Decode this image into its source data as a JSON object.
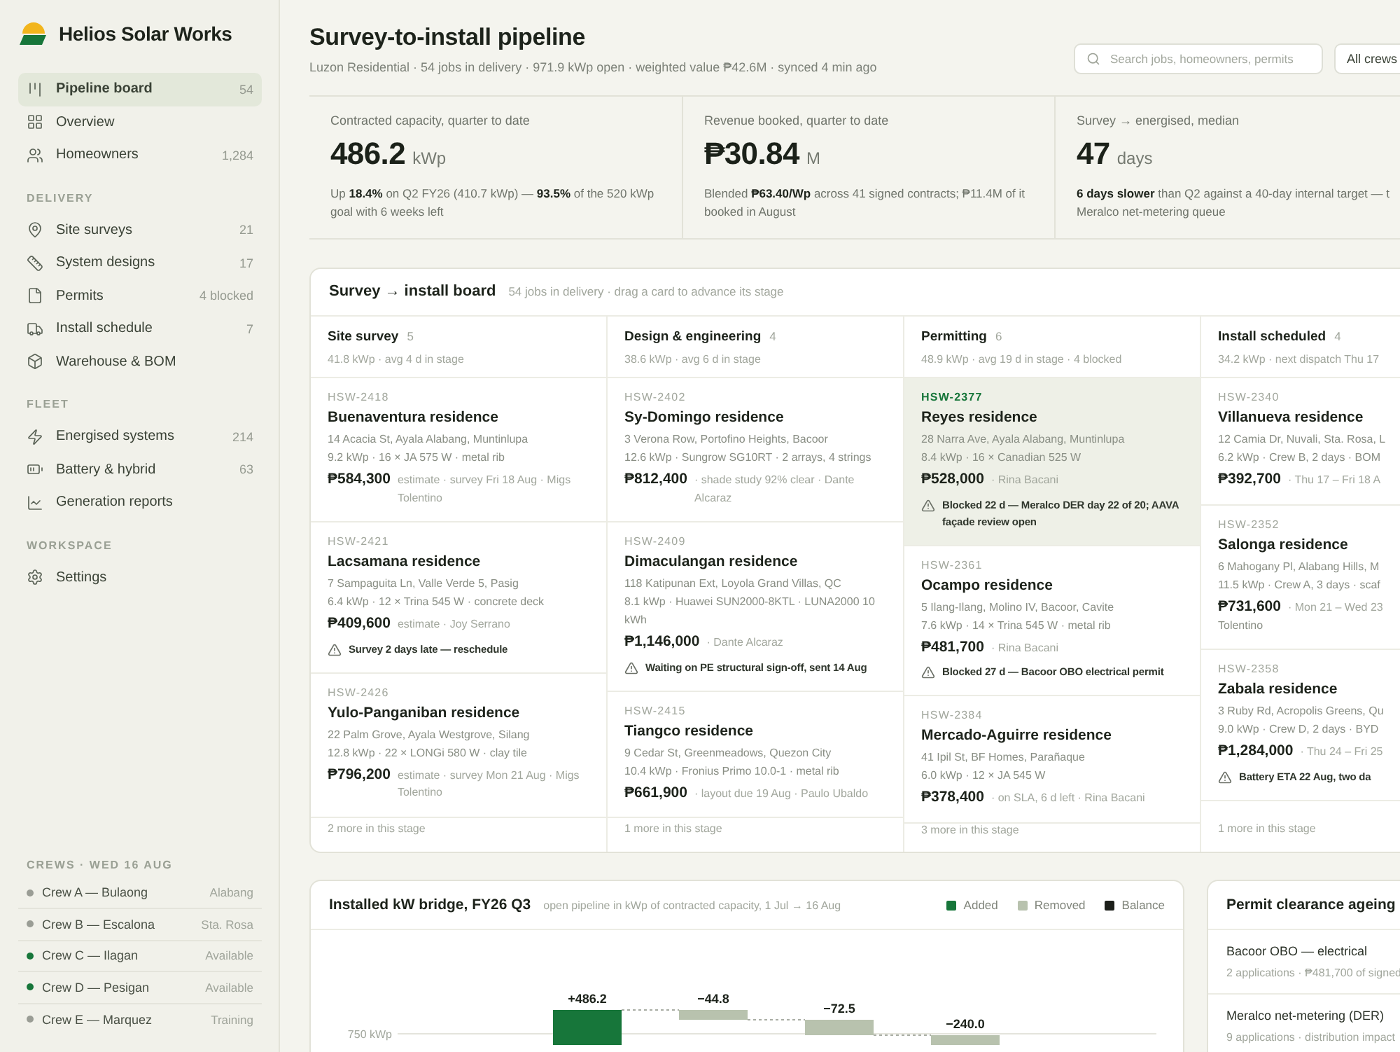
{
  "sidebar": {
    "brand": "Helios Solar Works",
    "nav": [
      {
        "label": "Pipeline board",
        "count": "54",
        "selected": true
      },
      {
        "label": "Overview",
        "selected": false
      },
      {
        "label": "Homeowners",
        "count": "1,284",
        "selected": false
      }
    ],
    "sections": [
      {
        "title": "DELIVERY",
        "items": [
          {
            "label": "Site surveys",
            "count": "21",
            "selected": false
          },
          {
            "label": "System designs",
            "count": "17",
            "selected": false
          },
          {
            "label": "Permits",
            "count": "4 blocked",
            "selected": false
          },
          {
            "label": "Install schedule",
            "count": "7",
            "selected": false
          },
          {
            "label": "Warehouse & BOM",
            "selected": false
          }
        ]
      },
      {
        "title": "FLEET",
        "items": [
          {
            "label": "Energised systems",
            "count": "214",
            "selected": false
          },
          {
            "label": "Battery & hybrid",
            "count": "63",
            "selected": false
          },
          {
            "label": "Generation reports",
            "selected": false
          }
        ]
      },
      {
        "title": "WORKSPACE",
        "items": [
          {
            "label": "Settings",
            "selected": false
          }
        ]
      }
    ],
    "crews": {
      "title": "CREWS · WED 16 AUG",
      "items": [
        {
          "name": "Crew A — Bulaong",
          "status": "Alabang",
          "color": "#9a9d95"
        },
        {
          "name": "Crew B — Escalona",
          "status": "Sta. Rosa",
          "color": "#9a9d95"
        },
        {
          "name": "Crew C — Ilagan",
          "status": "Available",
          "color": "#17763a"
        },
        {
          "name": "Crew D — Pesigan",
          "status": "Available",
          "color": "#17763a"
        },
        {
          "name": "Crew E — Marquez",
          "status": "Training",
          "color": "#9a9d95"
        }
      ]
    }
  },
  "header": {
    "title": "Survey-to-install pipeline",
    "subtitle": "Luzon Residential · 54 jobs in delivery · 971.9 kWp open · weighted value ₱42.6M · synced 4 min ago",
    "search": {
      "placeholder": "Search jobs, homeowners, permits"
    },
    "crew_filter": {
      "value": "All crews"
    }
  },
  "kpis": [
    {
      "label": "Contracted capacity, quarter to date",
      "value": "486.2",
      "unit": "kWp",
      "lines": [
        "Up **18.4%** on Q2 FY26 (410.7 kWp) — **93.5%** of the 520 kWp",
        "goal with 6 weeks left"
      ]
    },
    {
      "label": "Revenue booked, quarter to date",
      "value": "₱30.84",
      "unit": "M",
      "lines": [
        "Blended **₱63.40/Wp** across 41 signed contracts; ₱11.4M of it",
        "booked in August"
      ]
    },
    {
      "label": "Survey → energised, median",
      "value": "47",
      "unit": "days",
      "lines": [
        "**6 days slower** than Q2 against a 40-day internal target — t",
        "Meralco net-metering queue"
      ]
    }
  ],
  "board": {
    "title": "Survey → install board",
    "subtitle": "54 jobs in delivery · drag a card to advance its stage",
    "columns": [
      {
        "title": "Site survey",
        "count": "5",
        "summary": "41.8 kWp · avg 4 d in stage",
        "more": "2 more in this stage",
        "cards": [
          {
            "id": "HSW-2418",
            "name": "Buenaventura residence",
            "address": "14 Acacia St, Ayala Alabang, Muntinlupa",
            "spec": "9.2 kWp · 16 × JA 575 W · metal rib",
            "price": "₱584,300",
            "meta": "estimate · survey Fri 18 Aug · Migs Tolentino",
            "selected": false
          },
          {
            "id": "HSW-2421",
            "name": "Lacsamana residence",
            "address": "7 Sampaguita Ln, Valle Verde 5, Pasig",
            "spec": "6.4 kWp · 12 × Trina 545 W · concrete deck",
            "price": "₱409,600",
            "meta": "estimate · Joy Serrano",
            "alert": "Survey 2 days late — reschedule",
            "selected": false
          },
          {
            "id": "HSW-2426",
            "name": "Yulo-Panganiban residence",
            "address": "22 Palm Grove, Ayala Westgrove, Silang",
            "spec": "12.8 kWp · 22 × LONGi 580 W · clay tile",
            "price": "₱796,200",
            "meta": "estimate · survey Mon 21 Aug · Migs Tolentino",
            "selected": false
          }
        ]
      },
      {
        "title": "Design & engineering",
        "count": "4",
        "summary": "38.6 kWp · avg 6 d in stage",
        "more": "1 more in this stage",
        "cards": [
          {
            "id": "HSW-2402",
            "name": "Sy-Domingo residence",
            "address": "3 Verona Row, Portofino Heights, Bacoor",
            "spec": "12.6 kWp · Sungrow SG10RT · 2 arrays, 4 strings",
            "price": "₱812,400",
            "meta": "· shade study 92% clear · Dante Alcaraz",
            "selected": false
          },
          {
            "id": "HSW-2409",
            "name": "Dimaculangan residence",
            "address": "118 Katipunan Ext, Loyola Grand Villas, QC",
            "spec": "8.1 kWp · Huawei SUN2000-8KTL · LUNA2000 10 kWh",
            "price": "₱1,146,000",
            "meta": "· Dante Alcaraz",
            "alert": "Waiting on PE structural sign-off, sent 14 Aug",
            "selected": false
          },
          {
            "id": "HSW-2415",
            "name": "Tiangco residence",
            "address": "9 Cedar St, Greenmeadows, Quezon City",
            "spec": "10.4 kWp · Fronius Primo 10.0-1 · metal rib",
            "price": "₱661,900",
            "meta": "· layout due 19 Aug · Paulo Ubaldo",
            "selected": false
          }
        ]
      },
      {
        "title": "Permitting",
        "count": "6",
        "summary": "48.9 kWp · avg 19 d in stage · 4 blocked",
        "more": "3 more in this stage",
        "cards": [
          {
            "id": "HSW-2377",
            "name": "Reyes residence",
            "address": "28 Narra Ave, Ayala Alabang, Muntinlupa",
            "spec": "8.4 kWp · 16 × Canadian 525 W",
            "price": "₱528,000",
            "meta": "· Rina Bacani",
            "alert": "Blocked 22 d — Meralco DER day 22 of 20; AAVA façade review open",
            "selected": true
          },
          {
            "id": "HSW-2361",
            "name": "Ocampo residence",
            "address": "5 Ilang-Ilang, Molino IV, Bacoor, Cavite",
            "spec": "7.6 kWp · 14 × Trina 545 W · metal rib",
            "price": "₱481,700",
            "meta": "· Rina Bacani",
            "alert": "Blocked 27 d — Bacoor OBO electrical permit",
            "selected": false
          },
          {
            "id": "HSW-2384",
            "name": "Mercado-Aguirre residence",
            "address": "41 Ipil St, BF Homes, Parañaque",
            "spec": "6.0 kWp · 12 × JA 545 W",
            "price": "₱378,400",
            "meta": "· on SLA, 6 d left · Rina Bacani",
            "selected": false
          }
        ]
      },
      {
        "title": "Install scheduled",
        "count": "4",
        "summary": "34.2 kWp · next dispatch Thu 17",
        "more": "1 more in this stage",
        "cards": [
          {
            "id": "HSW-2340",
            "name": "Villanueva residence",
            "address": "12 Camia Dr, Nuvali, Sta. Rosa, L",
            "spec": "6.2 kWp · Crew B, 2 days · BOM",
            "price": "₱392,700",
            "meta": "· Thu 17 – Fri 18 A",
            "selected": false
          },
          {
            "id": "HSW-2352",
            "name": "Salonga residence",
            "address": "6 Mahogany Pl, Alabang Hills, M",
            "spec": "11.5 kWp · Crew A, 3 days · scaf",
            "price": "₱731,600",
            "meta": "· Mon 21 – Wed 23",
            "meta_cont": "Tolentino",
            "selected": false
          },
          {
            "id": "HSW-2358",
            "name": "Zabala residence",
            "address": "3 Ruby Rd, Acropolis Greens, Qu",
            "spec": "9.0 kWp · Crew D, 2 days · BYD",
            "price": "₱1,284,000",
            "meta": "· Thu 24 – Fri 25",
            "alert": "Battery ETA 22 Aug, two da",
            "selected": false
          }
        ]
      }
    ]
  },
  "bridge": {
    "title": "Installed kW bridge, FY26 Q3",
    "subtitle": "open pipeline in kWp of contracted capacity, 1 Jul → 16 Aug",
    "legend": [
      {
        "label": "Added",
        "color": "#17763a"
      },
      {
        "label": "Removed",
        "color": "#b8c2ae"
      },
      {
        "label": "Balance",
        "color": "#1c1f1a"
      }
    ],
    "gridline_label": "750 kWp",
    "bars": [
      {
        "label": "+486.2",
        "kind": "added"
      },
      {
        "label": "−44.8",
        "kind": "removed"
      },
      {
        "label": "−72.5",
        "kind": "removed"
      },
      {
        "label": "−240.0",
        "kind": "removed"
      }
    ]
  },
  "permit_ageing": {
    "title": "Permit clearance ageing",
    "rows": [
      {
        "name": "Bacoor OBO — electrical",
        "detail": "2 applications · ₱481,700 of signed"
      },
      {
        "name": "Meralco net-metering (DER)",
        "detail": "9 applications · distribution impact"
      }
    ]
  }
}
